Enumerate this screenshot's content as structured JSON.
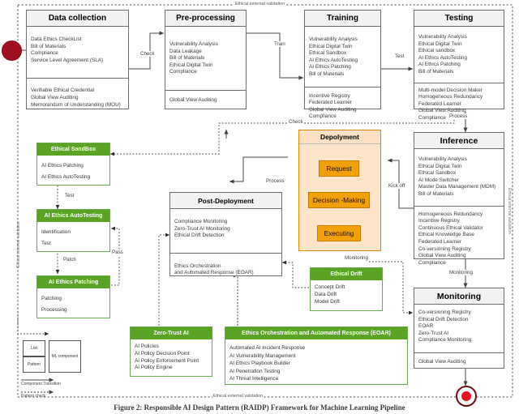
{
  "figure": {
    "caption": "Figure 2: Responsible AI Design Pattern (RAIDP) Framework for Machine Learning Pipeline",
    "boundary_label_top": "Ethical external validation",
    "boundary_label_bottom": "Ethical external validation",
    "boundary_label_left": "Ethical external validation",
    "boundary_label_right": "Ethical external validation"
  },
  "nodes": {
    "start": {
      "name": "start-node"
    },
    "end": {
      "name": "end-node"
    }
  },
  "boxes": {
    "data_collection": {
      "title": "Data collection",
      "section1": [
        "Data Ethics CheckList",
        "Bill of Materials",
        "Compliance",
        "Service Level Agreement (SLA)"
      ],
      "section2": [
        "Verifiable Ethical Credential",
        "Global View Auditing",
        "Memorandum of Understanding (MOU)"
      ]
    },
    "pre_processing": {
      "title": "Pre-processing",
      "section1": [
        "Vulnerability Analysis",
        "Data Leakage",
        "Bill of Materials",
        "Ethical Digital Twin",
        "Compliance"
      ],
      "section2": [
        "Global View Auditing"
      ]
    },
    "training": {
      "title": "Training",
      "section1": [
        "Vulnerability Analysis",
        "Ethical Digital Twin",
        "Ethical Sandbox",
        "AI Ethics AutoTesting",
        "AI Ethics Patching",
        "Bill of Materials"
      ],
      "section2": [
        "Incentive Registry",
        "Federated Learner",
        "Global View Auditing",
        "Compliance"
      ]
    },
    "testing": {
      "title": "Testing",
      "section1": [
        "Vulnerability Analysis",
        "Ethical Digital Twin",
        "Ethical sandbox",
        "AI Ethics AutoTesting",
        "AI Ethics Patching",
        "Bill of Materials"
      ],
      "section2": [
        "Multi-model Decision Maker",
        "Homogeneous Redundancy",
        "Federated Learner",
        "Global View Auditing",
        "Compliance"
      ]
    },
    "inference": {
      "title": "Inference",
      "section1": [
        "Vulnerability Analysis",
        "Ethical Digital Twin",
        "Ethical Sandbox",
        "AI Mode Switcher",
        "Master Data Management (MDM)",
        "Bill of Materials"
      ],
      "section2": [
        "Homogeneous Redundancy",
        "Incentive Registry",
        "Continuous Ethical Validator",
        "Ethical Knowledge Base",
        "Federated Learner",
        "Co-versioning Registry",
        "Global View Auditing",
        "Compliance"
      ]
    },
    "monitoring": {
      "title": "Monitoring",
      "section1": [
        "Co-versioning Registry",
        "Ethical Drift Detection",
        "EOAR",
        "Zero-Trust AI",
        "Compliance Monitoring"
      ],
      "section2": [
        "Global View Auditing"
      ]
    },
    "post_deployment": {
      "title": "Post-Deployment",
      "section1": [
        "Compliance Monitoring",
        "Zero-Trust AI Monitoring",
        "Ethical Drift Detection"
      ],
      "section2": [
        "Ethics Orchestration",
        "and Automated Response (EOAR)"
      ]
    },
    "deployment": {
      "title": "Depolyment",
      "steps": [
        "Request",
        "Decision -Making",
        "Executing"
      ]
    },
    "ethical_sandbox": {
      "title": "Ethical SandBox",
      "items": [
        "AI Ethics Patching",
        "AI Ethics AutoTesting"
      ]
    },
    "ai_ethics_autotesting": {
      "title": "AI Ethics AutoTesting",
      "items": [
        "Identification",
        "Test"
      ]
    },
    "ai_ethics_patching": {
      "title": "AI Ethics Patching",
      "items": [
        "Patching",
        "Processing"
      ]
    },
    "ethical_drift": {
      "title": "Ethical Drift",
      "items": [
        "Concept Drift",
        "Data Drift",
        "Model Drift"
      ]
    },
    "zero_trust_ai": {
      "title": "Zero-Trust AI",
      "items": [
        "AI Policies",
        "AI Policy Decision Point",
        "AI Policy Enforcement Point",
        "AI Policy Engine"
      ]
    },
    "eoar": {
      "title": "Ethics Orchestration and Automated Response (EOAR)",
      "items": [
        "Automated AI Incident Response",
        "AI Vulnerability Management",
        "AI Ethics Playbook Builder",
        "AI Penetration Testing",
        "AI Threat Intelligence"
      ]
    }
  },
  "edges": {
    "check_1": "Check",
    "train": "Train",
    "test_1": "Test",
    "process_1": "Process",
    "check_2": "Check",
    "process_2": "Process",
    "kick_off": "Kick off",
    "monitoring_1": "Monitoring",
    "monitoring_2": "Monitoring",
    "test_2": "Test",
    "patch": "Patch",
    "pass": "Pass"
  },
  "legend": {
    "list": "List",
    "pattern": "Pattern",
    "ml_component": "ML component",
    "component_transition": "Component Transition",
    "pattern_check": "Pattern check"
  },
  "colors": {
    "green_header": "#5aa324",
    "green_border": "#6aa84f",
    "orange_step": "#f2a007",
    "orange_fill": "#fce4c8",
    "grey_header": "#f2f2f2",
    "start_node": "#a10f1e",
    "end_node": "#e8161f"
  }
}
